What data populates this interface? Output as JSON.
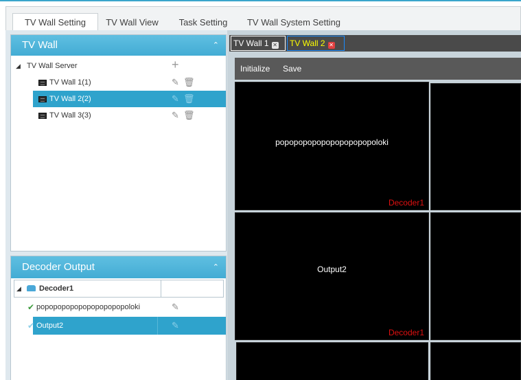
{
  "top_tabs": [
    "TV Wall Setting",
    "TV Wall View",
    "Task Setting",
    "TV Wall System Setting"
  ],
  "tv_wall_panel": {
    "title": "TV Wall",
    "server_label": "TV Wall Server",
    "items": [
      "TV Wall 1(1)",
      "TV Wall 2(2)",
      "TV Wall 3(3)"
    ],
    "selected_index": 1
  },
  "decoder_panel": {
    "title": "Decoder Output",
    "decoder_label": "Decoder1",
    "outputs": [
      "popopopopopopopopopopoloki",
      "Output2"
    ],
    "selected_index": 1
  },
  "wall_tabs": [
    {
      "label": "TV Wall 1",
      "active": false
    },
    {
      "label": "TV Wall 2",
      "active": true
    }
  ],
  "toolbar": {
    "initialize": "Initialize",
    "save": "Save"
  },
  "screens": [
    {
      "text": "popopopopopopopopopopoloki",
      "decoder": "Decoder1"
    },
    {
      "text": "",
      "decoder": ""
    },
    {
      "text": "Output2",
      "decoder": "Decoder1"
    },
    {
      "text": "",
      "decoder": ""
    },
    {
      "text": "",
      "decoder": ""
    },
    {
      "text": "",
      "decoder": ""
    }
  ],
  "colors": {
    "accent": "#2fa3cc",
    "panel_header": "#4fb5dc",
    "decoder_label": "#e01010",
    "active_tab_text": "#ffff00",
    "screen_bg": "#000000"
  },
  "icons": {
    "collapse": "chevron-up-icon",
    "add": "plus-icon",
    "edit": "edit-icon",
    "delete": "trash-icon",
    "check": "check-icon",
    "monitor": "monitor-icon",
    "decoder": "decoder-icon",
    "close_tab": "close-icon"
  }
}
